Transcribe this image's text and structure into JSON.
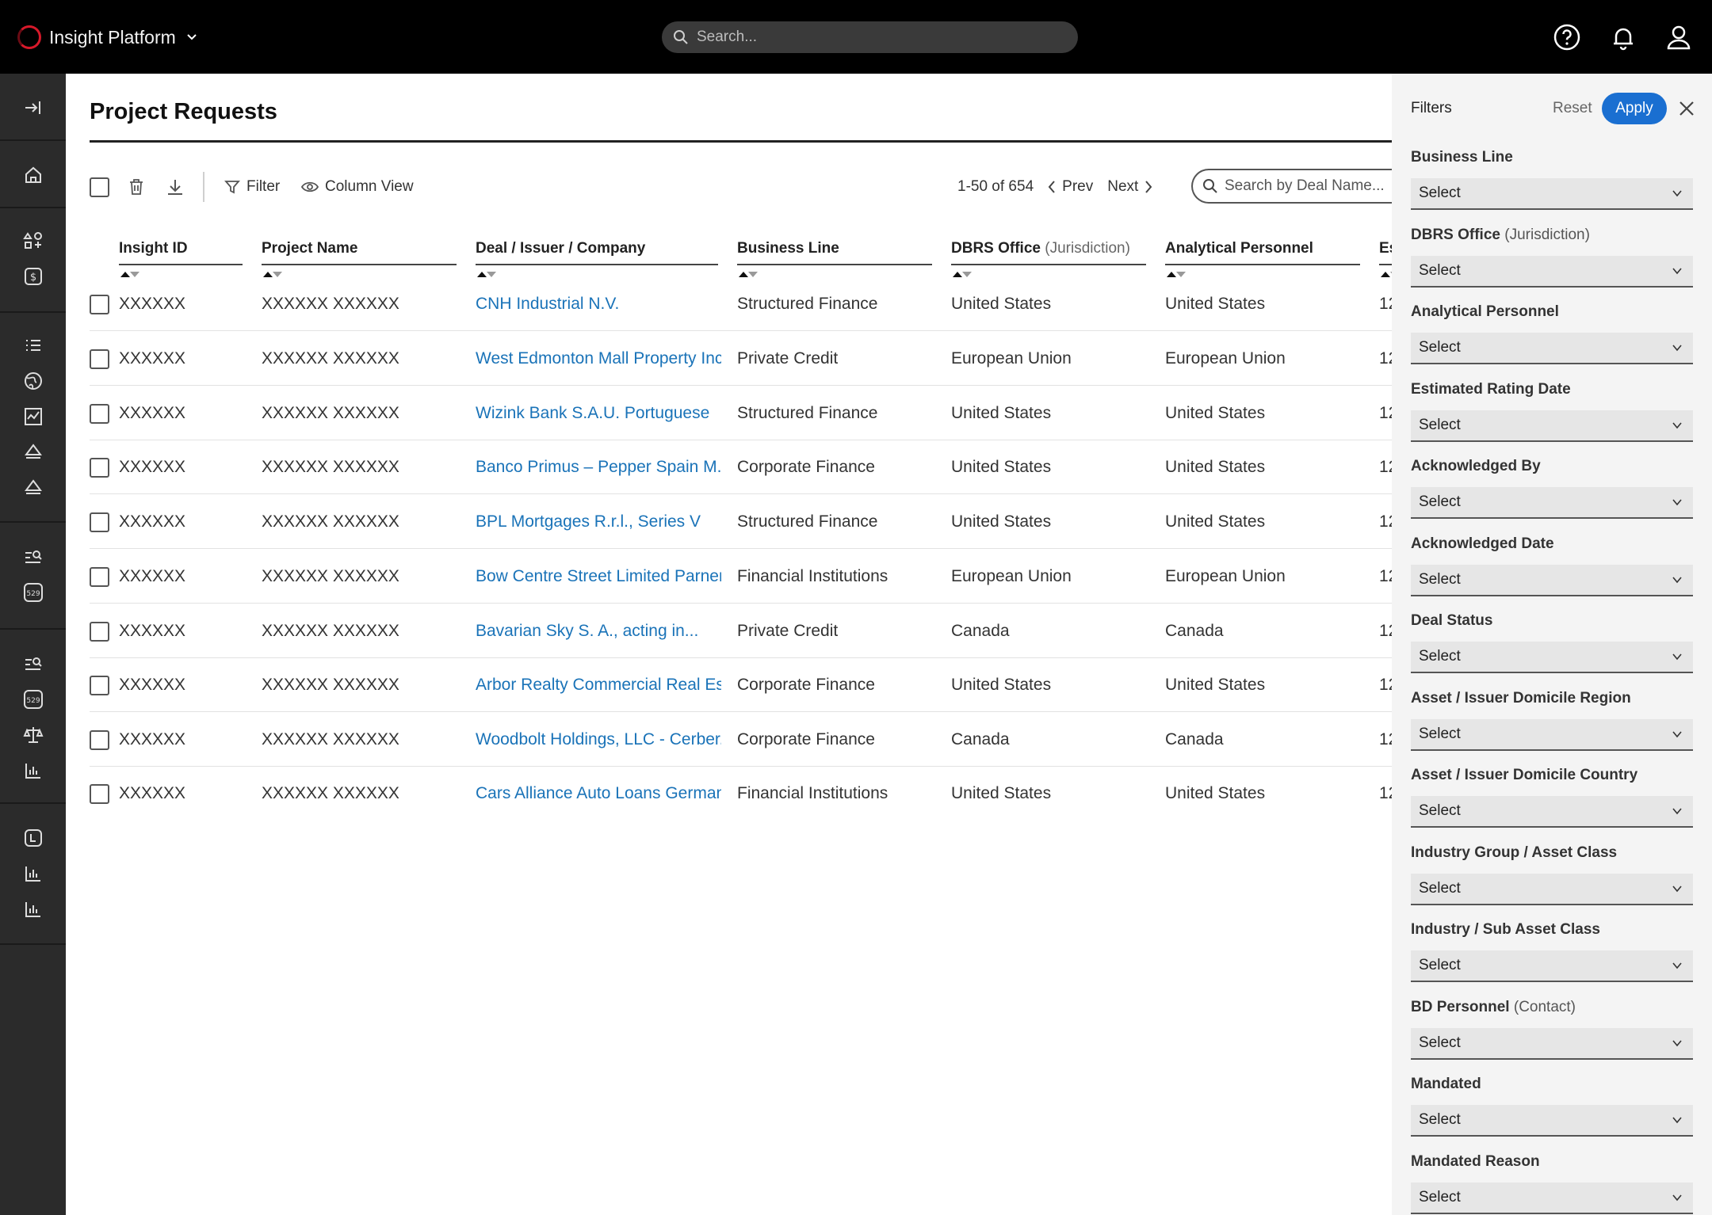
{
  "app": {
    "name": "Insight Platform"
  },
  "search": {
    "placeholder": "Search..."
  },
  "page": {
    "title": "Project Requests"
  },
  "toolbar": {
    "filter_label": "Filter",
    "column_view_label": "Column View",
    "range": "1-50 of 654",
    "prev_label": "Prev",
    "next_label": "Next",
    "deal_search_placeholder": "Search by Deal Name..."
  },
  "columns": {
    "insight_id": "Insight ID",
    "project_name": "Project Name",
    "deal": "Deal / Issuer / Company",
    "business_line": "Business Line",
    "office": "DBRS Office",
    "office_suffix": "(Jurisdiction)",
    "personnel": "Analytical Personnel",
    "est": "Es"
  },
  "rows": [
    {
      "id": "XXXXXX",
      "project": "XXXXXX XXXXXX",
      "deal": "CNH Industrial N.V.",
      "business_line": "Structured Finance",
      "office": "United States",
      "personnel": "United States",
      "est": "12"
    },
    {
      "id": "XXXXXX",
      "project": "XXXXXX XXXXXX",
      "deal": "West Edmonton Mall Property Inc.",
      "business_line": "Private Credit",
      "office": "European Union",
      "personnel": "European Union",
      "est": "12"
    },
    {
      "id": "XXXXXX",
      "project": "XXXXXX XXXXXX",
      "deal": "Wizink Bank S.A.U. Portuguese",
      "business_line": "Structured Finance",
      "office": "United States",
      "personnel": "United States",
      "est": "12"
    },
    {
      "id": "XXXXXX",
      "project": "XXXXXX XXXXXX",
      "deal": "Banco Primus – Pepper Spain M...",
      "business_line": "Corporate Finance",
      "office": "United States",
      "personnel": "United States",
      "est": "12"
    },
    {
      "id": "XXXXXX",
      "project": "XXXXXX XXXXXX",
      "deal": "BPL Mortgages R.r.l., Series V",
      "business_line": "Structured Finance",
      "office": "United States",
      "personnel": "United States",
      "est": "12"
    },
    {
      "id": "XXXXXX",
      "project": "XXXXXX XXXXXX",
      "deal": "Bow Centre Street Limited Parner...",
      "business_line": "Financial Institutions",
      "office": "European Union",
      "personnel": "European Union",
      "est": "12"
    },
    {
      "id": "XXXXXX",
      "project": "XXXXXX XXXXXX",
      "deal": "Bavarian Sky S. A., acting in...",
      "business_line": "Private Credit",
      "office": "Canada",
      "personnel": "Canada",
      "est": "12"
    },
    {
      "id": "XXXXXX",
      "project": "XXXXXX XXXXXX",
      "deal": "Arbor Realty Commercial Real Es...",
      "business_line": "Corporate Finance",
      "office": "United States",
      "personnel": "United States",
      "est": "12"
    },
    {
      "id": "XXXXXX",
      "project": "XXXXXX XXXXXX",
      "deal": "Woodbolt Holdings, LLC - Cerber...",
      "business_line": "Corporate Finance",
      "office": "Canada",
      "personnel": "Canada",
      "est": "12"
    },
    {
      "id": "XXXXXX",
      "project": "XXXXXX XXXXXX",
      "deal": "Cars Alliance Auto Loans German...",
      "business_line": "Financial Institutions",
      "office": "United States",
      "personnel": "United States",
      "est": "12"
    }
  ],
  "filters": {
    "title": "Filters",
    "reset_label": "Reset",
    "apply_label": "Apply",
    "groups": [
      {
        "label": "Business Line",
        "suffix": "",
        "value": "Select"
      },
      {
        "label": "DBRS Office",
        "suffix": "(Jurisdiction)",
        "value": "Select"
      },
      {
        "label": "Analytical Personnel",
        "suffix": "",
        "value": "Select"
      },
      {
        "label": "Estimated Rating Date",
        "suffix": "",
        "value": "Select"
      },
      {
        "label": "Acknowledged By",
        "suffix": "",
        "value": "Select"
      },
      {
        "label": "Acknowledged Date",
        "suffix": "",
        "value": "Select"
      },
      {
        "label": "Deal Status",
        "suffix": "",
        "value": "Select"
      },
      {
        "label": "Asset / Issuer Domicile Region",
        "suffix": "",
        "value": "Select"
      },
      {
        "label": "Asset / Issuer Domicile Country",
        "suffix": "",
        "value": "Select"
      },
      {
        "label": "Industry Group / Asset Class",
        "suffix": "",
        "value": "Select"
      },
      {
        "label": "Industry / Sub Asset Class",
        "suffix": "",
        "value": "Select"
      },
      {
        "label": "BD Personnel",
        "suffix": "(Contact)",
        "value": "Select"
      },
      {
        "label": "Mandated",
        "suffix": "",
        "value": "Select"
      },
      {
        "label": "Mandated Reason",
        "suffix": "",
        "value": "Select"
      }
    ]
  },
  "rail_badge": "529"
}
